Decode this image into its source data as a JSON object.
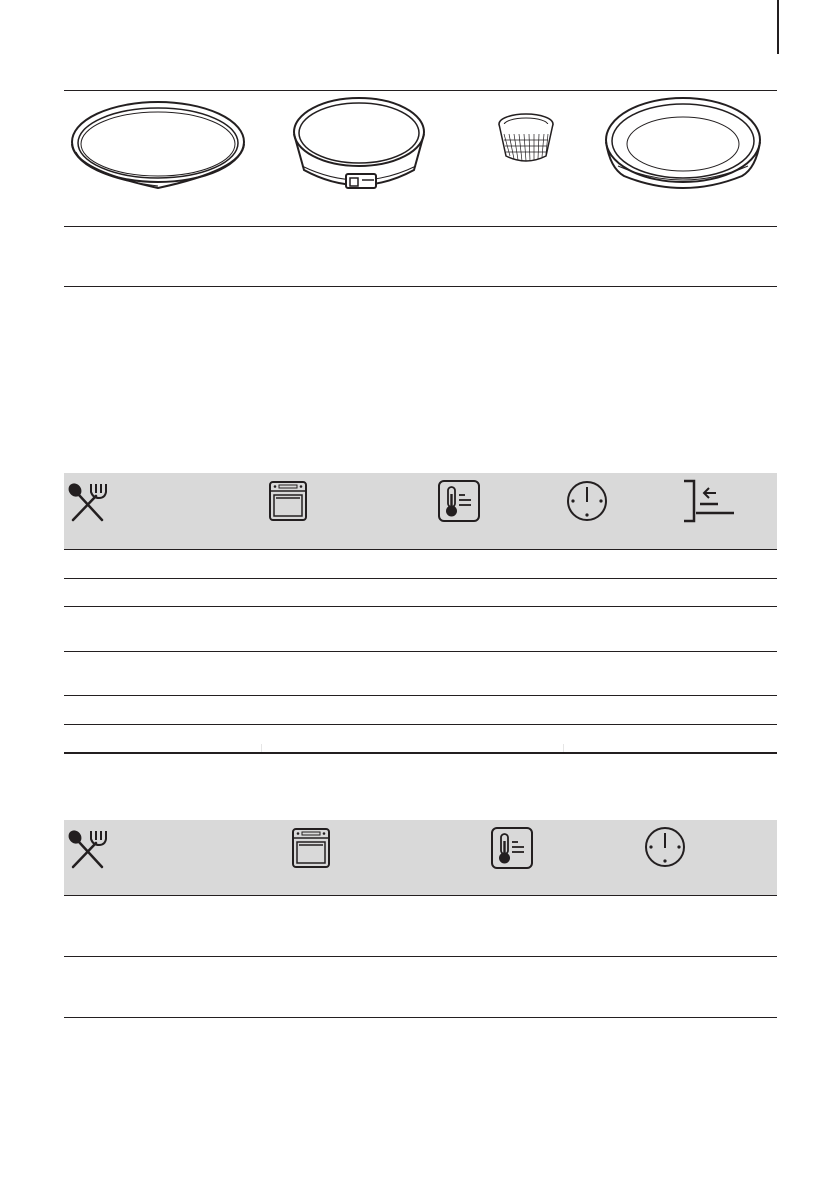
{
  "page": {
    "margin_marker": "margin-bar"
  },
  "bakeware": {
    "items": [
      {
        "name": "shallow-round-tin-icon"
      },
      {
        "name": "springform-tin-icon"
      },
      {
        "name": "ramekin-icon"
      },
      {
        "name": "deep-round-dish-icon"
      }
    ]
  },
  "table_1": {
    "header_icons": [
      "cutlery-icon",
      "oven-icon",
      "thermometer-icon",
      "clock-icon",
      "shelf-level-icon"
    ],
    "rows": 6
  },
  "table_2": {
    "header_icons": [
      "cutlery-icon",
      "oven-icon",
      "thermometer-icon",
      "clock-icon"
    ],
    "rows": 2
  },
  "colors": {
    "line": "#231f20",
    "header_bg": "#d9d9d9",
    "icon_stroke": "#231f20"
  }
}
